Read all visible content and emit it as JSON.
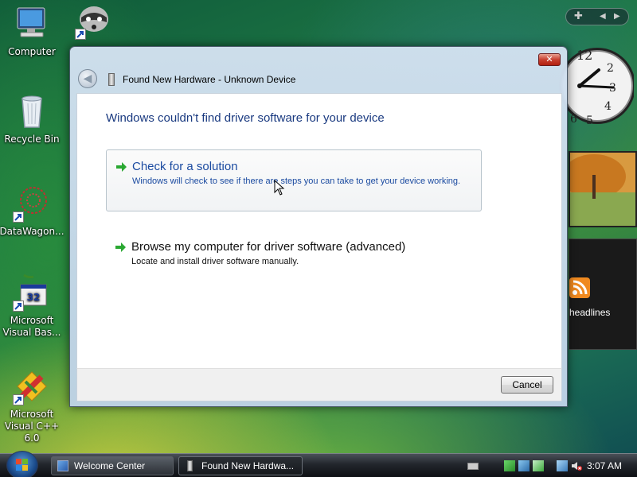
{
  "desktop": {
    "icons": [
      {
        "label": "Computer"
      },
      {
        "label": "Recycle Bin"
      },
      {
        "label": "DataWagon..."
      },
      {
        "label": "Microsoft Visual Bas..."
      },
      {
        "label": "Microsoft Visual C++ 6.0"
      }
    ]
  },
  "gadgets": {
    "feed_label": "headlines"
  },
  "dialog": {
    "title": "Found New Hardware - Unknown Device",
    "close_label": "✕",
    "heading": "Windows couldn't find driver software for your device",
    "options": [
      {
        "title": "Check for a solution",
        "description": "Windows will check to see if there are steps you can take to get your device working."
      },
      {
        "title": "Browse my computer for driver software (advanced)",
        "description": "Locate and install driver software manually."
      }
    ],
    "cancel_label": "Cancel"
  },
  "taskbar": {
    "buttons": [
      {
        "label": "Welcome Center",
        "active": false
      },
      {
        "label": "Found New Hardwa...",
        "active": true
      }
    ],
    "clock": "3:07 AM"
  },
  "colors": {
    "heading": "#1a3a80",
    "link": "#1a4aa0",
    "arrow": "#2aa832"
  }
}
